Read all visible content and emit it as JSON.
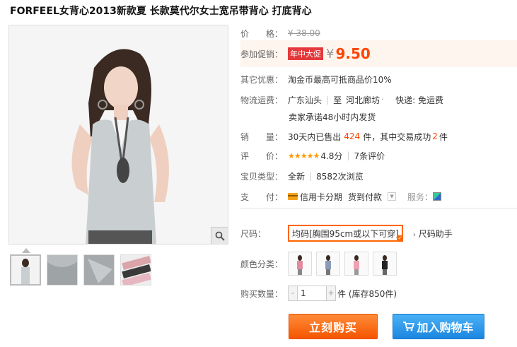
{
  "title": "FORFEEL女背心2013新款夏 长款莫代尔女士宽吊带背心 打底背心",
  "price": {
    "label": "价　　格：",
    "original": "¥ 38.00"
  },
  "promo": {
    "label": "参加促销：",
    "tag": "年中大促",
    "currency": "¥",
    "value": "9.50"
  },
  "discount": {
    "label": "其它优惠：",
    "text": "淘金币最高可抵商品价10%"
  },
  "shipping": {
    "label": "物流运费：",
    "from": "广东汕头",
    "to_prefix": "至",
    "to": "河北廊坊",
    "method": "快递: 免运费",
    "note": "卖家承诺48小时内发货"
  },
  "sales": {
    "label": "销　　量：",
    "prefix": "30天内已售出",
    "sold": "424",
    "middle": "件，其中交易成功",
    "success": "2",
    "suffix": "件"
  },
  "rating": {
    "label": "评　　价：",
    "stars": "★★★★★",
    "score": "4.8分",
    "reviews": "7条评价"
  },
  "item_type": {
    "label": "宝贝类型：",
    "condition": "全新",
    "views": "8582次浏览"
  },
  "payment": {
    "label": "支　　付：",
    "credit": "信用卡分期",
    "cod": "货到付款",
    "service_label": "服务："
  },
  "size": {
    "label": "尺码：",
    "selected": "均码[胸围95cm或以下可穿]",
    "help": "尺码助手"
  },
  "color": {
    "label": "颜色分类："
  },
  "quantity": {
    "label": "购买数量：",
    "value": "1",
    "stock": "件 (库存850件)",
    "minus": "-",
    "plus": "+"
  },
  "actions": {
    "buy": "立刻购买",
    "cart": "加入购物车"
  },
  "colors": {
    "accent": "#ff4400",
    "buy": "#f55500",
    "cart": "#1b86e0",
    "tag": "#e4393c"
  }
}
